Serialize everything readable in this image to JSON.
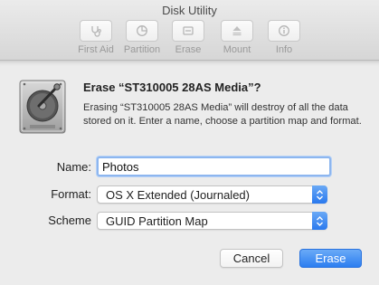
{
  "window": {
    "title": "Disk Utility"
  },
  "toolbar": [
    {
      "label": "First Aid",
      "icon": "stethoscope-icon"
    },
    {
      "label": "Partition",
      "icon": "pie-chart-icon"
    },
    {
      "label": "Erase",
      "icon": "eraser-icon"
    },
    {
      "label": "Mount",
      "icon": "eject-mount-icon"
    },
    {
      "label": "Info",
      "icon": "info-icon"
    }
  ],
  "sheet": {
    "icon": "hard-disk-icon",
    "heading": "Erase “ST310005 28AS Media”?",
    "description": "Erasing “ST310005 28AS Media” will destroy of all the data stored on it. Enter a name, choose a partition map and format.",
    "name_label": "Name:",
    "name_value": "Photos",
    "format_label": "Format:",
    "format_value": "OS X Extended (Journaled)",
    "scheme_label": "Scheme",
    "scheme_value": "GUID Partition Map",
    "cancel_label": "Cancel",
    "erase_label": "Erase"
  },
  "colors": {
    "accent": "#2c7ef0",
    "focus_ring": "#8db6ef"
  }
}
